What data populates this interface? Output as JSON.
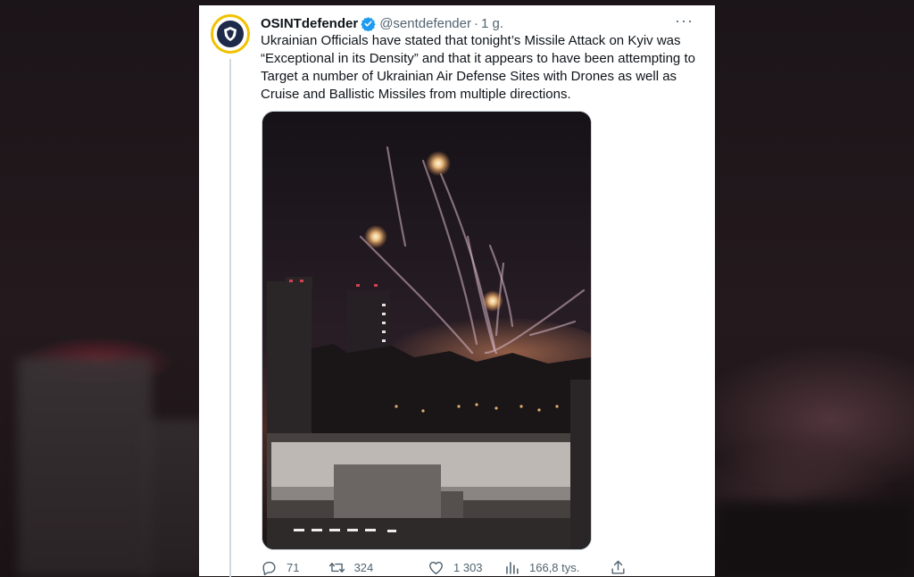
{
  "tweet": {
    "author_name": "OSINTdefender",
    "author_handle": "@sentdefender",
    "separator": "·",
    "time": "1 g.",
    "more_label": "···",
    "text": "Ukrainian Officials have stated that tonight’s Missile Attack on Kyiv was “Exceptional in its Density” and that it appears to have been attempting to Target a number of Ukrainian Air Defense Sites with Drones as well as Cruise and Ballistic Missiles from multiple directions."
  },
  "actions": {
    "replies": "71",
    "retweets": "324",
    "likes": "1 303",
    "views": "166,8 tys."
  },
  "icons": [
    "verified-badge-icon",
    "more-icon",
    "reply-icon",
    "retweet-icon",
    "like-icon",
    "views-icon",
    "share-icon"
  ],
  "colors": {
    "verified": "#1d9bf0",
    "text": "#0f1419",
    "secondary": "#536471",
    "avatar_ring": "#f2c200"
  }
}
